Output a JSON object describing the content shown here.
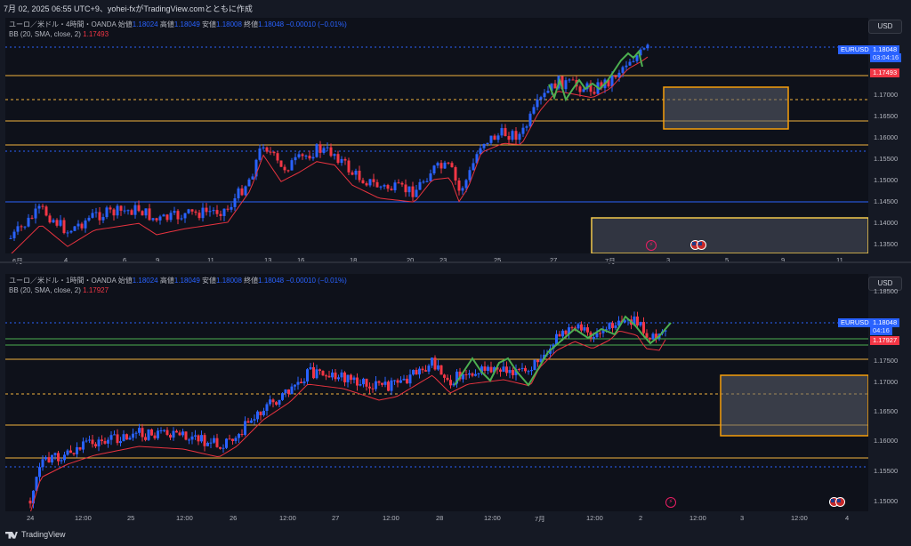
{
  "header": {
    "text": "7月 02, 2025 06:55 UTC+9、yohei-fxがTradingView.comとともに作成"
  },
  "footer": {
    "brand": "TradingView"
  },
  "colors": {
    "bull": "#2962ff",
    "bear": "#f23645",
    "basis": "#e8333f",
    "wave": "#4caf50",
    "hline": "#f2b33d",
    "blueline": "#2962ff",
    "zone": "#f59e0b"
  },
  "top": {
    "legend": {
      "symbol": "ユーロ／米ドル・4時間・OANDA",
      "open_l": "始値",
      "open": "1.18024",
      "high_l": "高値",
      "high": "1.18049",
      "low_l": "安値",
      "low": "1.18008",
      "close_l": "終値",
      "close": "1.18048",
      "change": "−0.00010 (−0.01%)",
      "bb": "BB (20, SMA, close, 2)",
      "bb_val": "1.17493"
    },
    "currency": "USD",
    "price_axis": [
      "1.17000",
      "1.16500",
      "1.16000",
      "1.15500",
      "1.15000",
      "1.14500",
      "1.14000",
      "1.13500"
    ],
    "symbol_tag": "EURUSD",
    "price_tag": "1.18048",
    "timer": "03:04:16",
    "bb_tag": "1.17493",
    "x_labels": [
      "6月",
      "4",
      "6",
      "9",
      "11",
      "13",
      "16",
      "18",
      "20",
      "23",
      "25",
      "27",
      "7月",
      "3",
      "5",
      "9",
      "11"
    ]
  },
  "bottom": {
    "legend": {
      "symbol": "ユーロ／米ドル・1時間・OANDA",
      "open_l": "始値",
      "open": "1.18024",
      "high_l": "高値",
      "high": "1.18049",
      "low_l": "安値",
      "low": "1.18008",
      "close_l": "終値",
      "close": "1.18048",
      "change": "−0.00010 (−0.01%)",
      "bb": "BB (20, SMA, close, 2)",
      "bb_val": "1.17927"
    },
    "currency": "USD",
    "price_axis": [
      "1.18500",
      "1.17500",
      "1.17000",
      "1.16500",
      "1.16000",
      "1.15500",
      "1.15000"
    ],
    "symbol_tag": "EURUSD",
    "price_tag": "1.18048",
    "timer": "04:16",
    "bb_tag": "1.17927",
    "x_labels": [
      "24",
      "12:00",
      "25",
      "12:00",
      "26",
      "12:00",
      "27",
      "12:00",
      "28",
      "12:00",
      "7月",
      "12:00",
      "2",
      "12:00",
      "3",
      "12:00",
      "4"
    ]
  }
}
